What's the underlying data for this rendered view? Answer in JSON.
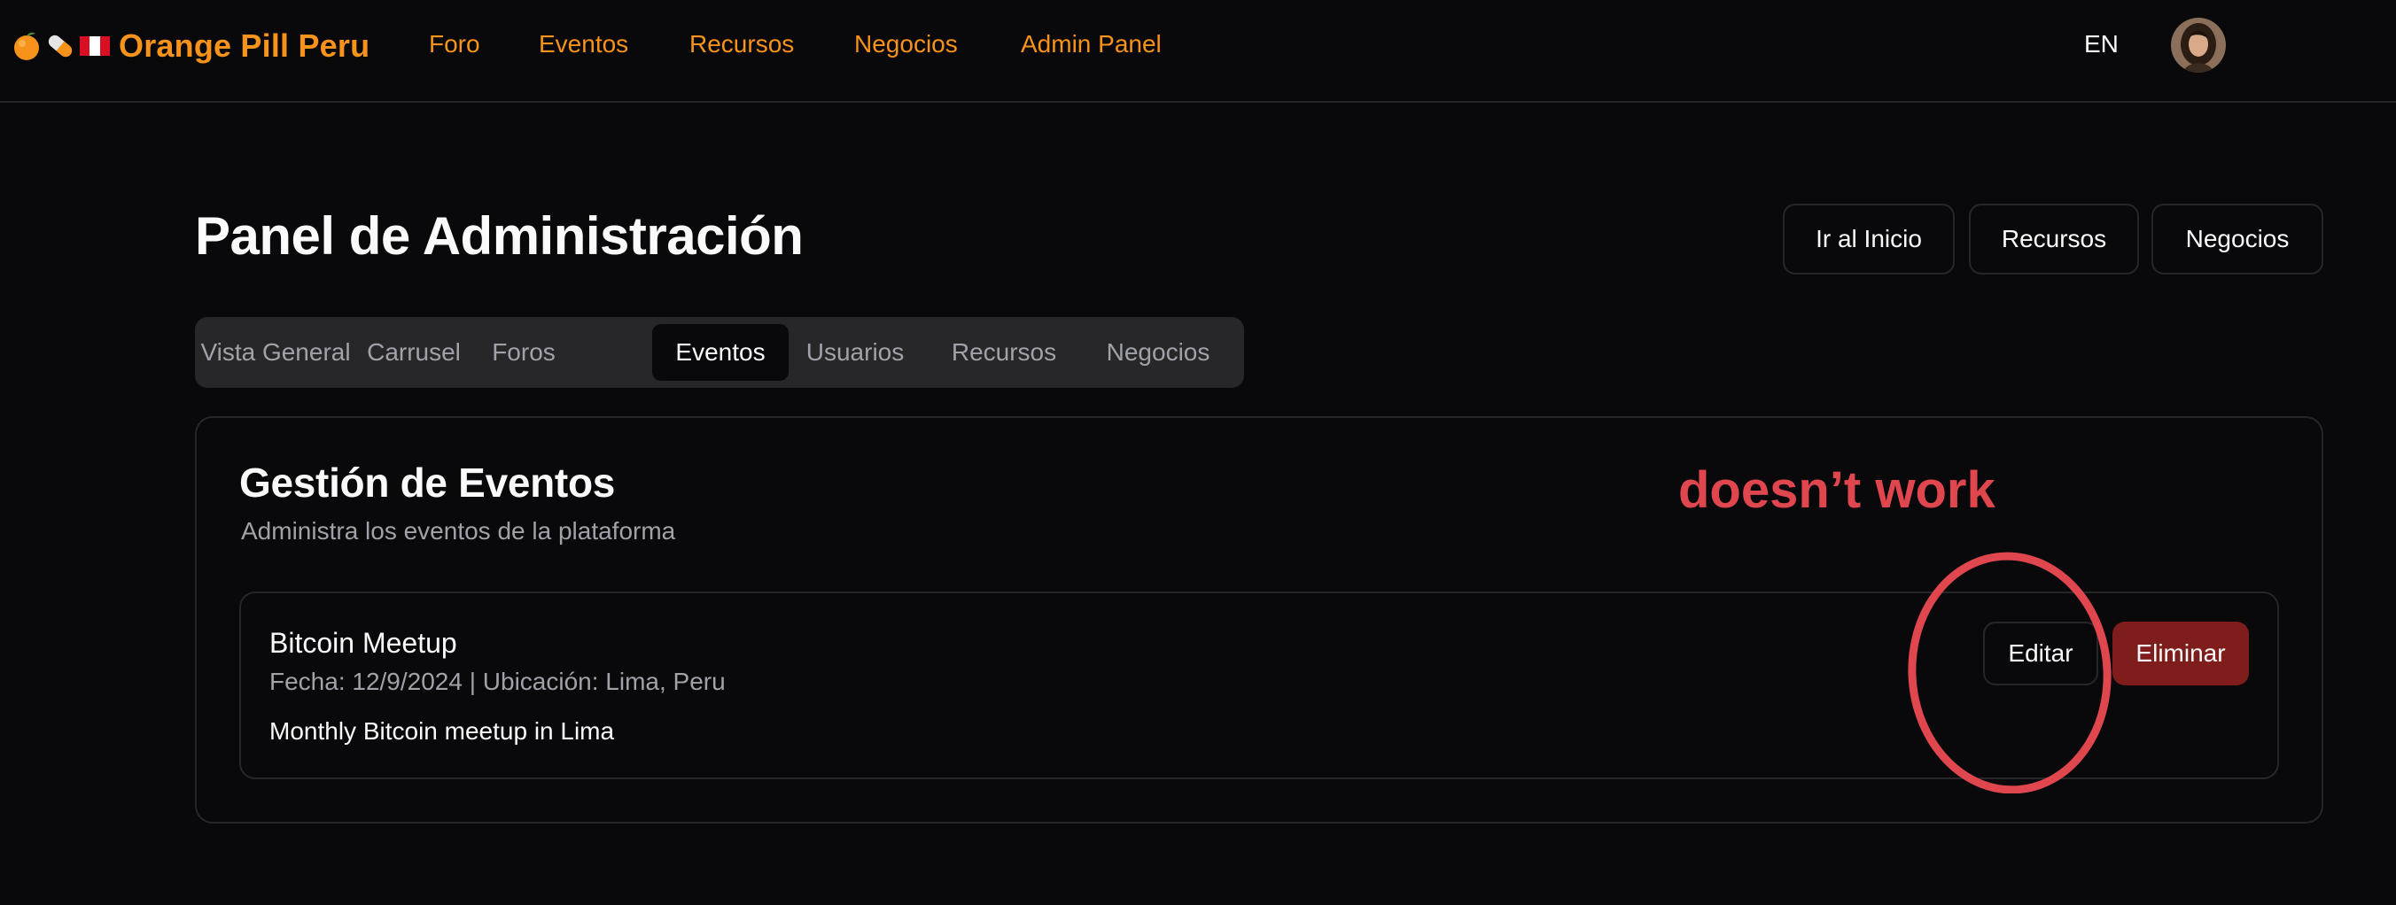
{
  "navbar": {
    "brand_icons": [
      "orange-icon",
      "pill-icon",
      "peru-flag-icon"
    ],
    "brand_name": "Orange Pill Peru",
    "links": [
      "Foro",
      "Eventos",
      "Recursos",
      "Negocios",
      "Admin Panel"
    ],
    "language": "EN",
    "accent_color": "#f7931a"
  },
  "header": {
    "title": "Panel de Administración",
    "buttons": [
      "Ir al Inicio",
      "Recursos",
      "Negocios"
    ]
  },
  "tabs": {
    "items": [
      "Vista General",
      "Carrusel",
      "Foros",
      "Eventos",
      "Usuarios",
      "Recursos",
      "Negocios"
    ],
    "active": "Eventos"
  },
  "card": {
    "title": "Gestión de Eventos",
    "description": "Administra los eventos de la plataforma"
  },
  "events": [
    {
      "title": "Bitcoin Meetup",
      "meta": "Fecha: 12/9/2024 | Ubicación: Lima, Peru",
      "description": "Monthly Bitcoin meetup in Lima",
      "edit_label": "Editar",
      "delete_label": "Eliminar"
    }
  ],
  "annotation": {
    "text": "doesn’t work",
    "color": "#e0464e"
  },
  "colors": {
    "background": "#09090b",
    "border": "#27272a",
    "muted_text": "#a1a1aa",
    "destructive": "#7f1d1d"
  }
}
